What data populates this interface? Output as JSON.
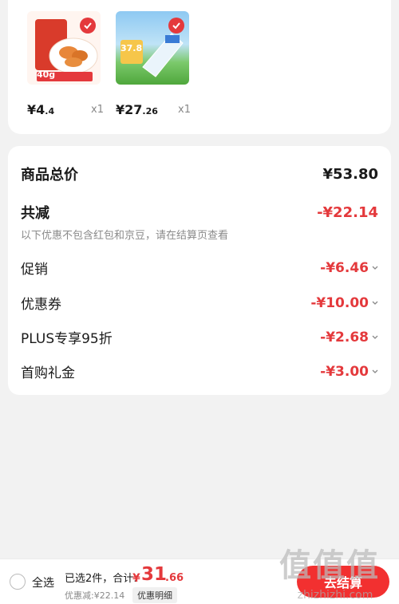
{
  "products": [
    {
      "price_int": "¥4",
      "price_dec": ".4",
      "qty": "x1",
      "badge": "40g"
    },
    {
      "price_int": "¥27",
      "price_dec": ".26",
      "qty": "x1",
      "badge": "37.8"
    }
  ],
  "summary": {
    "total_label": "商品总价",
    "total_value": "¥53.80",
    "reduce_label": "共减",
    "reduce_value": "-¥22.14",
    "note": "以下优惠不包含红包和京豆，请在结算页查看",
    "items": [
      {
        "label": "促销",
        "value": "-¥6.46"
      },
      {
        "label": "优惠券",
        "value": "-¥10.00"
      },
      {
        "label": "PLUS专享95折",
        "value": "-¥2.68"
      },
      {
        "label": "首购礼金",
        "value": "-¥3.00"
      }
    ]
  },
  "footer": {
    "select_all": "全选",
    "selected": "已选2件，合计:",
    "total_symbol": "¥",
    "total_int": "31",
    "total_dec": ".66",
    "discount": "优惠减:¥22.14",
    "detail": "优惠明细",
    "checkout": "去结算"
  },
  "watermark": {
    "glyphs": "值值值",
    "text": "zhizhizhi.com"
  },
  "colors": {
    "accent": "#e4393c",
    "checkout": "#f23030"
  }
}
